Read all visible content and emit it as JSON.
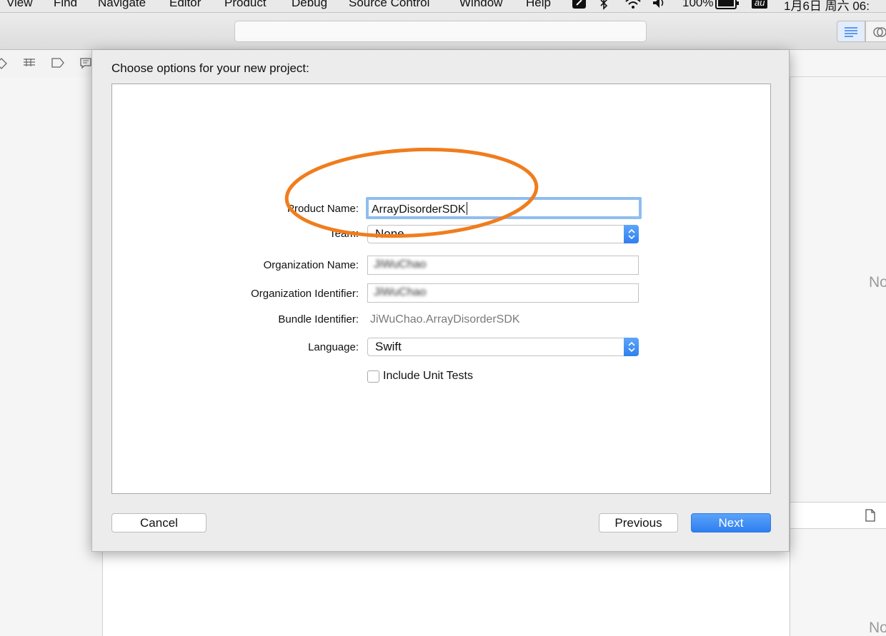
{
  "menubar": {
    "items": [
      "View",
      "Find",
      "Navigate",
      "Editor",
      "Product",
      "Debug",
      "Source Control",
      "Window",
      "Help"
    ],
    "battery": "100%",
    "input_method": "au",
    "clock": "1月6日 周六 06:"
  },
  "right_panel": {
    "no_label_top": "No",
    "no_label_bottom": "No"
  },
  "dialog": {
    "title": "Choose options for your new project:",
    "fields": {
      "product_name": {
        "label": "Product Name:",
        "value": "ArrayDisorderSDK"
      },
      "team": {
        "label": "Team:",
        "value": "None"
      },
      "organization_name": {
        "label": "Organization Name:",
        "value": "JiWuChao"
      },
      "organization_identifier": {
        "label": "Organization Identifier:",
        "value": "JiWuChao"
      },
      "bundle_identifier": {
        "label": "Bundle Identifier:",
        "value": "JiWuChao.ArrayDisorderSDK"
      },
      "language": {
        "label": "Language:",
        "value": "Swift"
      },
      "include_unit_tests": {
        "label": "Include Unit Tests",
        "checked": false
      }
    },
    "buttons": {
      "cancel": "Cancel",
      "previous": "Previous",
      "next": "Next"
    },
    "accent_color": "#2f7ef1",
    "annotation_color": "#f07d1d"
  }
}
